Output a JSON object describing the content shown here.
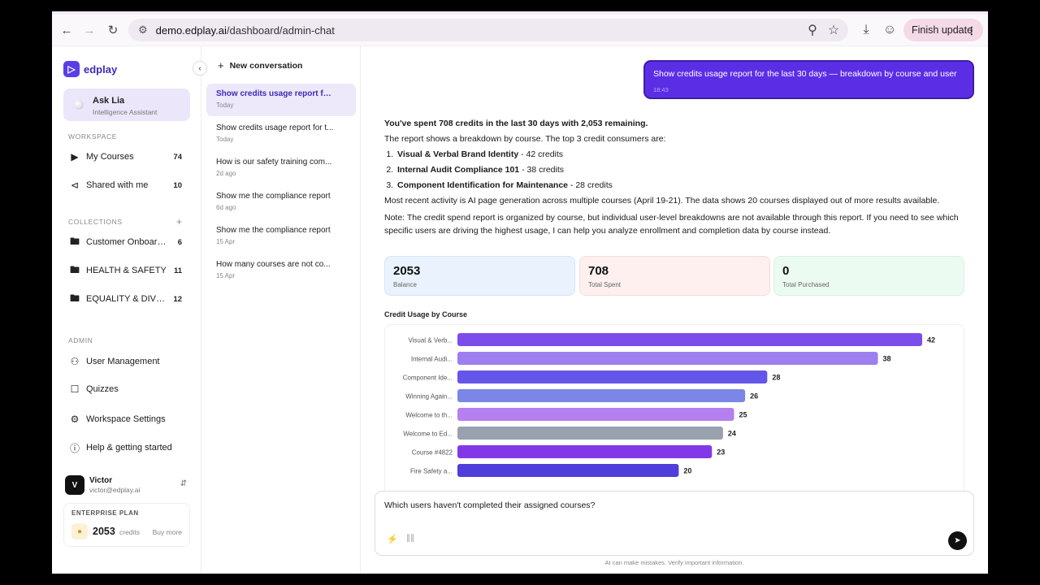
{
  "browser": {
    "url_host": "demo.edplay.ai",
    "url_path": "/dashboard/admin-chat",
    "finish_update_label": "Finish update"
  },
  "sidebar": {
    "brand": "edplay",
    "assistant_title": "Ask Lia",
    "assistant_subtitle": "Intelligence Assistant",
    "workspace_label": "WORKSPACE",
    "workspace_items": [
      {
        "label": "My Courses",
        "count": "74",
        "icon": "play-square-icon"
      },
      {
        "label": "Shared with me",
        "count": "10",
        "icon": "share-icon"
      }
    ],
    "collections_label": "COLLECTIONS",
    "collections": [
      {
        "label": "Customer Onboard...",
        "count": "6",
        "icon": "folder-icon"
      },
      {
        "label": "HEALTH & SAFETY",
        "count": "11",
        "icon": "folder-icon"
      },
      {
        "label": "EQUALITY & DIVE...",
        "count": "12",
        "icon": "folder-icon"
      }
    ],
    "admin_label": "ADMIN",
    "admin_items": [
      {
        "label": "User Management",
        "icon": "users-icon"
      },
      {
        "label": "Quizzes",
        "icon": "quiz-icon"
      },
      {
        "label": "Workspace Settings",
        "icon": "gear-icon"
      },
      {
        "label": "Help & getting started",
        "icon": "help-icon"
      }
    ],
    "user": {
      "initial": "V",
      "name": "Victor",
      "email": "victor@edplay.ai"
    },
    "plan": {
      "label": "ENTERPRISE PLAN",
      "credits": "2053",
      "unit": "credits",
      "buy": "Buy more"
    }
  },
  "conversations": {
    "new_label": "New conversation",
    "items": [
      {
        "title": "Show credits usage report for ...",
        "date": "Today",
        "active": true
      },
      {
        "title": "Show credits usage report for t...",
        "date": "Today"
      },
      {
        "title": "How is our safety training com...",
        "date": "2d ago"
      },
      {
        "title": "Show me the compliance report",
        "date": "6d ago"
      },
      {
        "title": "Show me the compliance report",
        "date": "15 Apr"
      },
      {
        "title": "How many courses are not co...",
        "date": "15 Apr"
      }
    ]
  },
  "chat": {
    "user_message": "Show credits usage report for the last 30 days — breakdown by course and user",
    "user_time": "18:43",
    "summary": "You've spent 708 credits in the last 30 days with 2,053 remaining.",
    "intro": "The report shows a breakdown by course. The top 3 credit consumers are:",
    "top": [
      {
        "name": "Visual & Verbal Brand Identity",
        "rest": " - 42 credits"
      },
      {
        "name": "Internal Audit Compliance 101",
        "rest": " - 38 credits"
      },
      {
        "name": "Component Identification for Maintenance",
        "rest": " - 28 credits"
      }
    ],
    "recent": "Most recent activity is AI page generation across multiple courses (April 19-21). The data shows 20 courses displayed out of more results available.",
    "note": "Note: The credit spend report is organized by course, but individual user-level breakdowns are not available through this report. If you need to see which specific users are driving the highest usage, I can help you analyze enrollment and completion data by course instead.",
    "stats": [
      {
        "value": "2053",
        "label": "Balance",
        "bg": "#eaf3fd",
        "border": "#d4e6f8"
      },
      {
        "value": "708",
        "label": "Total Spent",
        "bg": "#fdf0ef",
        "border": "#f6dcd9"
      },
      {
        "value": "0",
        "label": "Total Purchased",
        "bg": "#ecfbf1",
        "border": "#d5f2df"
      }
    ],
    "composer_text": "Which users haven't completed their assigned courses?",
    "disclaimer": "AI can make mistakes. Verify important information."
  },
  "chart_data": {
    "type": "bar",
    "orientation": "horizontal",
    "title": "Credit Usage by Course",
    "categories": [
      "Visual & Verb...",
      "Internal Audi...",
      "Component Ide...",
      "Winning Again...",
      "Welcome to th...",
      "Welcome to Ed...",
      "Course #4822",
      "Fire Safety a..."
    ],
    "values": [
      42,
      38,
      28,
      26,
      25,
      24,
      23,
      20
    ],
    "colors": [
      "#7c4dea",
      "#9d7ff0",
      "#6356e8",
      "#7b86e6",
      "#b57ff0",
      "#98a1ad",
      "#8338e8",
      "#4f3ddc"
    ],
    "xlim": [
      0,
      42
    ]
  }
}
